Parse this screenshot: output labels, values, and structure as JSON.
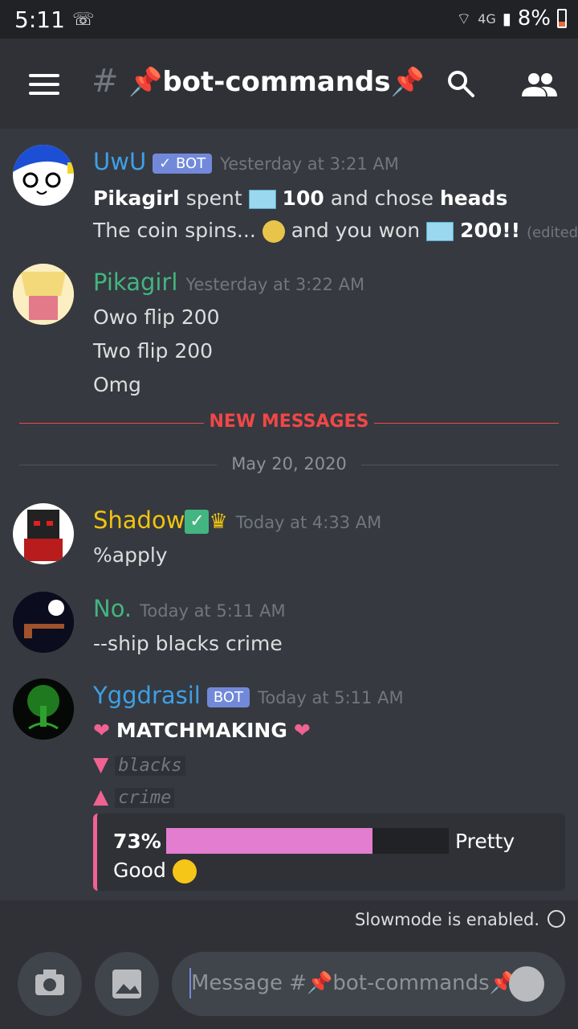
{
  "status_bar": {
    "time": "5:11",
    "network": "4G",
    "battery": "8%"
  },
  "toolbar": {
    "channel_prefix": "#",
    "channel_name": "bot-commands"
  },
  "messages": [
    {
      "author": "UwU",
      "author_color": "#3ea0e6",
      "bot_tag": "✓ BOT",
      "timestamp": "Yesterday at 3:21 AM",
      "lines": {
        "l1_user": "Pikagirl",
        "l1_spent": "spent",
        "l1_amount": "100",
        "l1_chose": "and chose",
        "l1_choice": "heads",
        "l2_a": "The coin spins...",
        "l2_b": "and you won",
        "l2_amount": "200!!",
        "edited": "(edited)"
      }
    },
    {
      "author": "Pikagirl",
      "author_color": "#43b581",
      "timestamp": "Yesterday at 3:22 AM",
      "lines": [
        "Owo flip 200",
        "Two flip 200",
        "Omg"
      ]
    },
    {
      "author": "Shadow",
      "author_color": "#f1c40f",
      "timestamp": "Today at 4:33 AM",
      "lines": [
        "%apply"
      ]
    },
    {
      "author": "No.",
      "author_color": "#43b581",
      "timestamp": "Today at 5:11 AM",
      "lines": [
        "--ship blacks crime"
      ]
    },
    {
      "author": "Yggdrasil",
      "author_color": "#3ea0e6",
      "bot_tag": "BOT",
      "timestamp": "Today at 5:11 AM",
      "heading": "MATCHMAKING",
      "name1": "blacks",
      "name2": "crime",
      "embed": {
        "percent_label": "73%",
        "percent": 0.73,
        "verdict_1": "Pretty",
        "verdict_2": "Good"
      }
    }
  ],
  "dividers": {
    "new_messages": "NEW MESSAGES",
    "date": "May 20, 2020"
  },
  "slowmode": {
    "text": "Slowmode is enabled."
  },
  "composer": {
    "placeholder_prefix": "Message #",
    "placeholder_channel": "bot-commands"
  }
}
